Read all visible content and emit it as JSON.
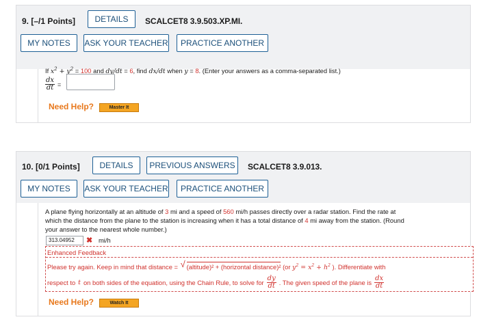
{
  "q9": {
    "title": "9.  [–/1 Points]",
    "details_label": "DETAILS",
    "code": "SCALCET8 3.9.503.XP.MI.",
    "my_notes_label": "MY NOTES",
    "ask_teacher_label": "ASK YOUR TEACHER",
    "practice_label": "PRACTICE ANOTHER",
    "prompt_if": "If",
    "eq1_value": "100",
    "eq2_value": "6",
    "find_text": ", find",
    "when_text": "when",
    "y_value": "8",
    "instr": ". (Enter your answers as a comma-separated list.)",
    "answer_value": "",
    "need_help": "Need Help?",
    "help_btn": "Master It"
  },
  "q10": {
    "title": "10.  [0/1 Points]",
    "details_label": "DETAILS",
    "prev_label": "PREVIOUS ANSWERS",
    "code": "SCALCET8 3.9.013.",
    "my_notes_label": "MY NOTES",
    "ask_teacher_label": "ASK YOUR TEACHER",
    "practice_label": "PRACTICE ANOTHER",
    "text_a": "A plane flying horizontally at an altitude of",
    "altitude": "3",
    "text_b": "mi and a speed of",
    "speed": "560",
    "text_c": "mi/h passes directly over a radar station. Find the rate at",
    "text_line2": "which the distance from the plane to the station is increasing when it has a total distance of",
    "distance": "4",
    "text_line2b": "mi away from the station. (Round",
    "text_line3": "your answer to the nearest whole number.)",
    "answer_value": "313.04952",
    "answer_unit": "mi/h",
    "feedback_title": "Enhanced Feedback",
    "fb_a": "Please try again. Keep in mind that distance =",
    "fb_rad": "(altitude)² + (horizontal distance)²",
    "fb_b": "(or",
    "fb_c": "). Differentiate with",
    "fb_line2a": "respect to",
    "fb_t": "t",
    "fb_line2b": "on both sides of the equation, using the Chain Rule, to solve for",
    "fb_line2c": ". The given speed of the plane is",
    "need_help": "Need Help?",
    "help_btn": "Watch It"
  },
  "colors": {
    "accent_blue": "#1b5e94",
    "error_red": "#d0312d",
    "help_orange": "#e8781c",
    "help_button": "#f4a523"
  }
}
